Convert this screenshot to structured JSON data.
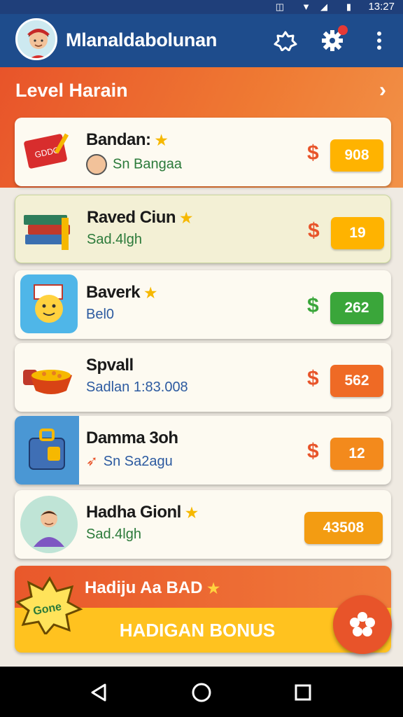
{
  "status_bar": {
    "time": "13:27"
  },
  "app": {
    "title": "Mlanaldabolunan"
  },
  "banner": {
    "title": "Level Harain"
  },
  "items": [
    {
      "title": "Bandan:",
      "subtitle": "Sn Bangaa",
      "value": "908",
      "badge_color": "#ffb300",
      "dollar_color": "#e8542a"
    },
    {
      "title": "Raved Ciun",
      "subtitle": "Sad.4lgh",
      "value": "19",
      "badge_color": "#ffb300",
      "dollar_color": "#e8542a"
    },
    {
      "title": "Baverk",
      "subtitle": "Bel0",
      "value": "262",
      "badge_color": "#3aa63a",
      "dollar_color": "#3aa63a"
    },
    {
      "title": "Spvall",
      "subtitle": "Sadlan 1:83.008",
      "value": "562",
      "badge_color": "#ef6a25",
      "dollar_color": "#e8542a"
    },
    {
      "title": "Damma 3oh",
      "subtitle": "Sn Sa2agu",
      "value": "12",
      "badge_color": "#f38a1c",
      "dollar_color": "#e8542a"
    },
    {
      "title": "Hadha Gionl",
      "subtitle": "Sad.4lgh",
      "value": "43508",
      "badge_color": "#f39c12",
      "dollar_color": "#e8542a"
    }
  ],
  "bonus": {
    "title": "Hadiju Aa BAD",
    "button": "HADIGAN BONUS",
    "burst_label": "Gone"
  },
  "icons": {
    "avatar": "user-avatar",
    "cookie": "cookie-icon",
    "settings": "gear-icon",
    "menu": "kebab-menu-icon",
    "fab": "flower-icon"
  }
}
